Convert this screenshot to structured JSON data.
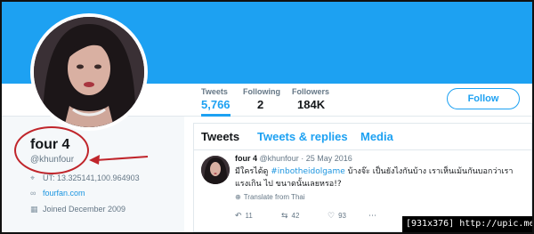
{
  "profile": {
    "name": "four 4",
    "handle": "@khunfour",
    "location": "ÜT: 13.325141,100.964903",
    "website": "fourfan.com",
    "joined": "Joined December 2009"
  },
  "stats": [
    {
      "label": "Tweets",
      "value": "5,766"
    },
    {
      "label": "Following",
      "value": "2"
    },
    {
      "label": "Followers",
      "value": "184K"
    }
  ],
  "follow_label": "Follow",
  "tabs": [
    "Tweets",
    "Tweets & replies",
    "Media"
  ],
  "tweet": {
    "name": "four 4",
    "handle": "@khunfour",
    "date": "· 25 May 2016",
    "text_before": "มีใครได้ดู ",
    "hashtag": "#inbotheidolgame",
    "text_after": " บ้างจ๊ะ เป็นยังไงกันบ้าง เราเห็นเม้นกันบอกว่าเราแรงเกิน ไป ขนาดนั้นเลยหรอ!?",
    "translate": "Translate from Thai",
    "replies": "11",
    "retweets": "42",
    "likes": "93"
  },
  "stamp": "[931x376] http://upic.me/",
  "colors": {
    "banner": "#1da1f2",
    "accent": "#1da1f2",
    "annotation": "#c0252b"
  },
  "icons": [
    "location-pin-icon",
    "link-icon",
    "calendar-icon",
    "reply-icon",
    "retweet-icon",
    "heart-icon",
    "more-icon"
  ]
}
